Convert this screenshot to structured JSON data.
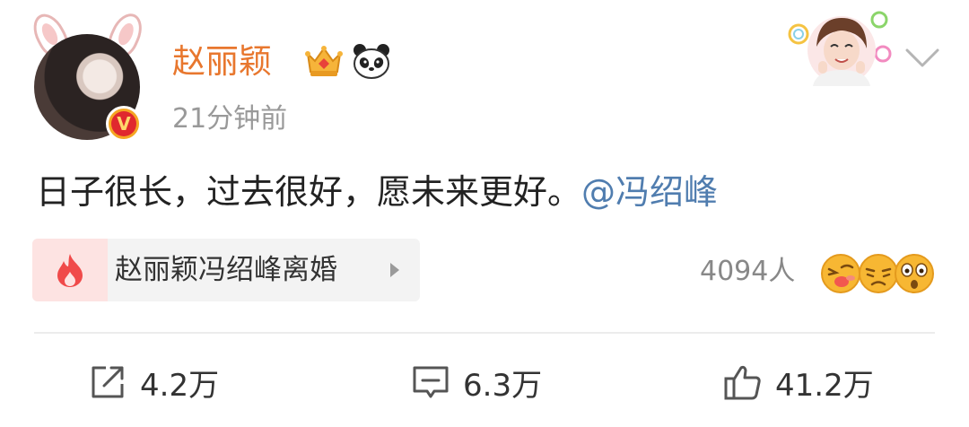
{
  "post": {
    "user": {
      "name": "赵丽颖",
      "verified_mark": "V"
    },
    "timestamp": "21分钟前",
    "text": "日子很长，过去很好，愿未来更好。",
    "mention": "@冯绍峰",
    "topic": {
      "label": "赵丽颖冯绍峰离婚",
      "icon": "flame-icon"
    },
    "reactions": {
      "count": "4094人",
      "emojis": [
        "kiss-emoji",
        "frown-emoji",
        "shock-emoji"
      ]
    }
  },
  "actions": {
    "repost": {
      "icon": "share-icon",
      "count": "4.2万"
    },
    "comment": {
      "icon": "comment-icon",
      "count": "6.3万"
    },
    "like": {
      "icon": "thumbs-up-icon",
      "count": "41.2万"
    }
  },
  "colors": {
    "username": "#e8772e",
    "mention": "#507daf",
    "timestamp": "#999999",
    "topic_bg": "#f3f3f3",
    "topic_icon_bg": "#fde3e2",
    "flame": "#f04a4a"
  }
}
